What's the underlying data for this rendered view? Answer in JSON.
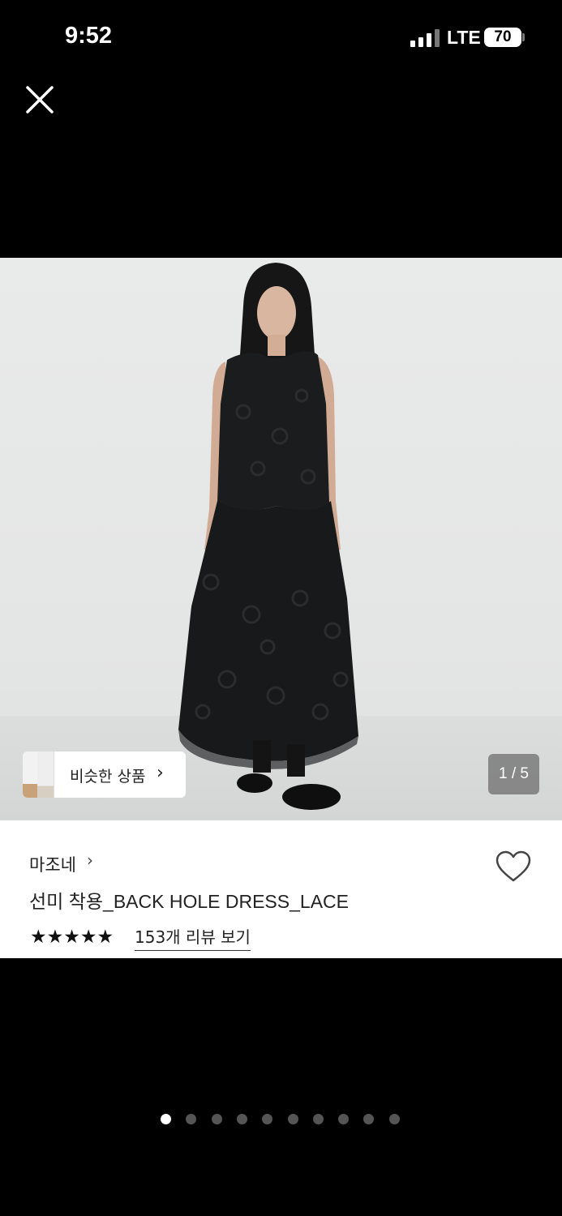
{
  "status_bar": {
    "time": "9:52",
    "network": "LTE",
    "battery": "70"
  },
  "viewer": {
    "close_icon": "close-icon",
    "similar_products_label": "비슷한 상품",
    "page_counter": "1 / 5"
  },
  "product": {
    "brand": "마조네",
    "name": "선미 착용_BACK HOLE DRESS_LACE",
    "rating_stars": "★★★★★",
    "reviews_link": "153개 리뷰 보기"
  },
  "pagination": {
    "total": 10,
    "active_index": 0
  }
}
